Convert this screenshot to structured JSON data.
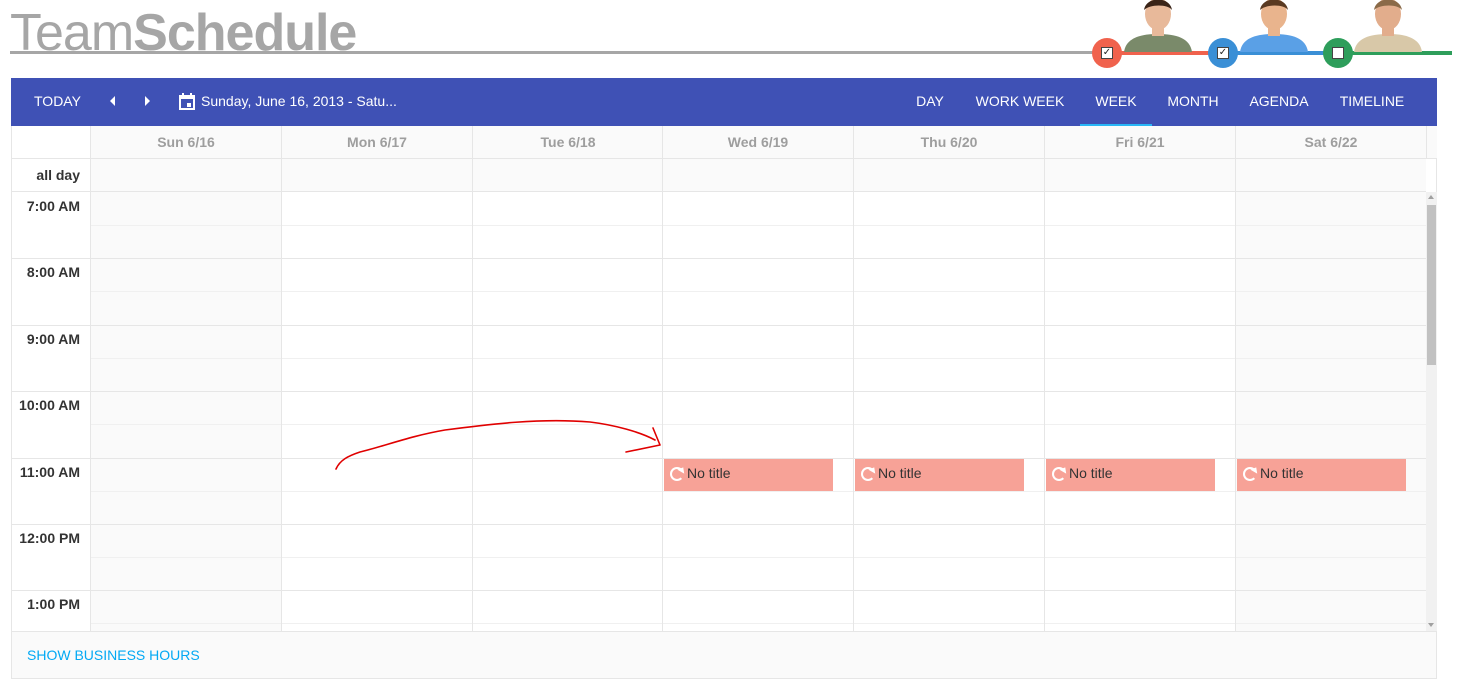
{
  "header": {
    "title_light": "Team",
    "title_bold": "Schedule"
  },
  "people": [
    {
      "name_icon": "woman-avatar-icon",
      "color": "#f0624d",
      "checked": true,
      "check_glyph": "✓"
    },
    {
      "name_icon": "man-avatar-icon",
      "color": "#3a8fd6",
      "checked": true,
      "check_glyph": "✓"
    },
    {
      "name_icon": "man-suit-avatar-icon",
      "color": "#2e9e5b",
      "checked": false,
      "check_glyph": ""
    }
  ],
  "toolbar": {
    "today_label": "TODAY",
    "date_range": "Sunday, June 16, 2013 - Satu...",
    "views": [
      {
        "label": "DAY",
        "active": false
      },
      {
        "label": "WORK WEEK",
        "active": false
      },
      {
        "label": "WEEK",
        "active": true
      },
      {
        "label": "MONTH",
        "active": false
      },
      {
        "label": "AGENDA",
        "active": false
      },
      {
        "label": "TIMELINE",
        "active": false
      }
    ]
  },
  "colors": {
    "toolbar_bg": "#3f51b5",
    "active_underline": "#29b6f6",
    "event_bg": "#f7a297",
    "link": "#03a9f4"
  },
  "grid": {
    "all_day_label": "all day",
    "days": [
      "Sun 6/16",
      "Mon 6/17",
      "Tue 6/18",
      "Wed 6/19",
      "Thu 6/20",
      "Fri 6/21",
      "Sat 6/22"
    ],
    "times": [
      "7:00 AM",
      "8:00 AM",
      "9:00 AM",
      "10:00 AM",
      "11:00 AM",
      "12:00 PM",
      "1:00 PM"
    ]
  },
  "events": [
    {
      "day_index": 3,
      "start": "11:00 AM",
      "title": "No title",
      "recurring": true
    },
    {
      "day_index": 4,
      "start": "11:00 AM",
      "title": "No title",
      "recurring": true
    },
    {
      "day_index": 5,
      "start": "11:00 AM",
      "title": "No title",
      "recurring": true
    },
    {
      "day_index": 6,
      "start": "11:00 AM",
      "title": "No title",
      "recurring": true
    }
  ],
  "footer": {
    "business_hours_label": "SHOW BUSINESS HOURS"
  }
}
